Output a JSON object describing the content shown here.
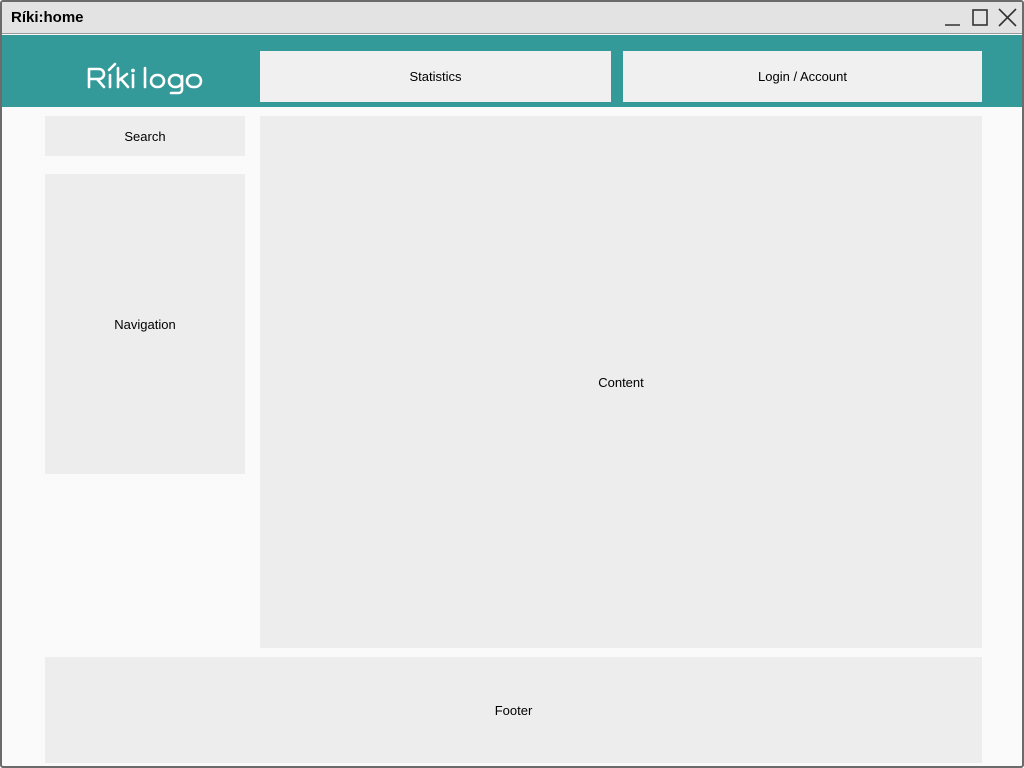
{
  "window": {
    "title": "Ríki:home",
    "controls": {
      "minimize_icon": "minimize-icon",
      "maximize_icon": "maximize-icon",
      "close_icon": "close-icon"
    }
  },
  "header": {
    "logo_text": "Ríki logo",
    "statistics_label": "Statistics",
    "account_label": "Login / Account"
  },
  "sidebar": {
    "search_label": "Search",
    "navigation_label": "Navigation"
  },
  "main": {
    "content_label": "Content"
  },
  "footer": {
    "label": "Footer"
  },
  "colors": {
    "header_bg": "#339999",
    "panel_bg": "#ededed",
    "titlebar_bg": "#e3e3e3"
  }
}
